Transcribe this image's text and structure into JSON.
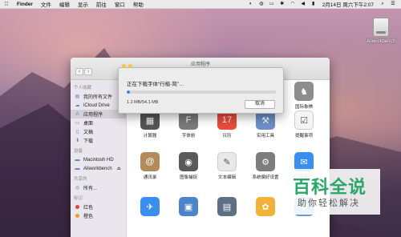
{
  "menubar": {
    "apple": "",
    "items": [
      "Finder",
      "文件",
      "编辑",
      "显示",
      "前往",
      "窗口",
      "帮助"
    ],
    "clock": "2月14日 周六下午2:07"
  },
  "desktop": {
    "drive_label": "Aliworkbench"
  },
  "finder": {
    "title": "应用程序",
    "sidebar": {
      "favorites_header": "个人收藏",
      "favorites": [
        {
          "label": "我的所有文件",
          "icon": "all-files-icon"
        },
        {
          "label": "iCloud Drive",
          "icon": "cloud-icon"
        },
        {
          "label": "应用程序",
          "icon": "applications-icon",
          "selected": true
        },
        {
          "label": "桌面",
          "icon": "desktop-icon"
        },
        {
          "label": "文稿",
          "icon": "documents-icon"
        },
        {
          "label": "下载",
          "icon": "downloads-icon"
        }
      ],
      "devices_header": "设备",
      "devices": [
        {
          "label": "Macintosh HD",
          "icon": "hard-drive-icon"
        },
        {
          "label": "Aliworkbench",
          "icon": "disk-icon",
          "eject": "⏏"
        }
      ],
      "shared_header": "共享的",
      "shared": [
        {
          "label": "所有...",
          "icon": "network-icon"
        }
      ],
      "tags_header": "标记",
      "tags": [
        {
          "label": "红色",
          "color": "#e2453c"
        },
        {
          "label": "橙色",
          "color": "#f29a2e"
        }
      ]
    },
    "apps": [
      {
        "label": "计算器",
        "icon": "calculator-icon",
        "color": "#555555"
      },
      {
        "label": "字体册",
        "icon": "font-book-icon",
        "color": "#7a7a7a"
      },
      {
        "label": "日历",
        "icon": "calendar-icon",
        "color": "#e94b3c"
      },
      {
        "label": "实用工具",
        "icon": "utilities-icon",
        "color": "#6d8fc7"
      },
      {
        "label": "提醒事项",
        "icon": "reminders-icon",
        "color": "#f4f4f4"
      },
      {
        "label": "国际象棋",
        "icon": "chess-icon",
        "color": "#8d8d8d"
      },
      {
        "label": "通讯录",
        "icon": "contacts-icon",
        "color": "#b38a5a"
      },
      {
        "label": "图像捕捉",
        "icon": "image-capture-icon",
        "color": "#5a5a5a"
      },
      {
        "label": "文本编辑",
        "icon": "textedit-icon",
        "color": "#e8e8e8"
      },
      {
        "label": "系统偏好设置",
        "icon": "system-preferences-icon",
        "color": "#7d7d7d"
      },
      {
        "label": "信息",
        "icon": "messages-icon",
        "color": "#3a8ef0"
      },
      {
        "label": "",
        "icon": "mail-icon",
        "color": "#3a8ef0"
      },
      {
        "label": "",
        "icon": "preview-icon",
        "color": "#4b84c9"
      },
      {
        "label": "",
        "icon": "photo-booth-icon",
        "color": "#5e6f86"
      },
      {
        "label": "",
        "icon": "photos-icon",
        "color": "#f2b23a"
      },
      {
        "label": "",
        "icon": "app-icon",
        "color": "#6e9ad4"
      }
    ]
  },
  "dialog": {
    "message": "正在下载字体“行楷-简”…",
    "progress": 0.022,
    "size_text": "1.2 MB/54.1 MB",
    "cancel_label": "取消"
  },
  "watermark": {
    "main": "百科全说",
    "sub": "助你轻松解决"
  }
}
